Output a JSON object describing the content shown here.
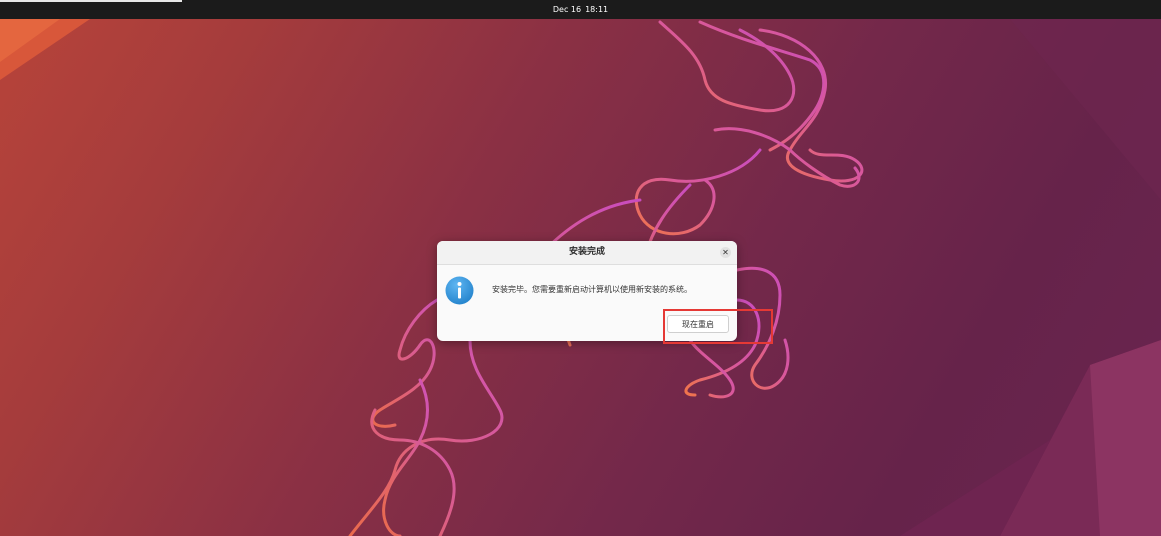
{
  "topbar": {
    "date": "Dec 16",
    "time": "18:11"
  },
  "dialog": {
    "title": "安装完成",
    "close_icon": "close-icon",
    "icon": "info-icon",
    "message": "安装完毕。您需要重新启动计算机以使用新安装的系统。",
    "restart_button": "现在重启"
  },
  "colors": {
    "topbar": "#1b1b1b",
    "dialog_bg": "#fafafa",
    "info_blue": "#2a8fd8",
    "highlight": "#e53935"
  }
}
